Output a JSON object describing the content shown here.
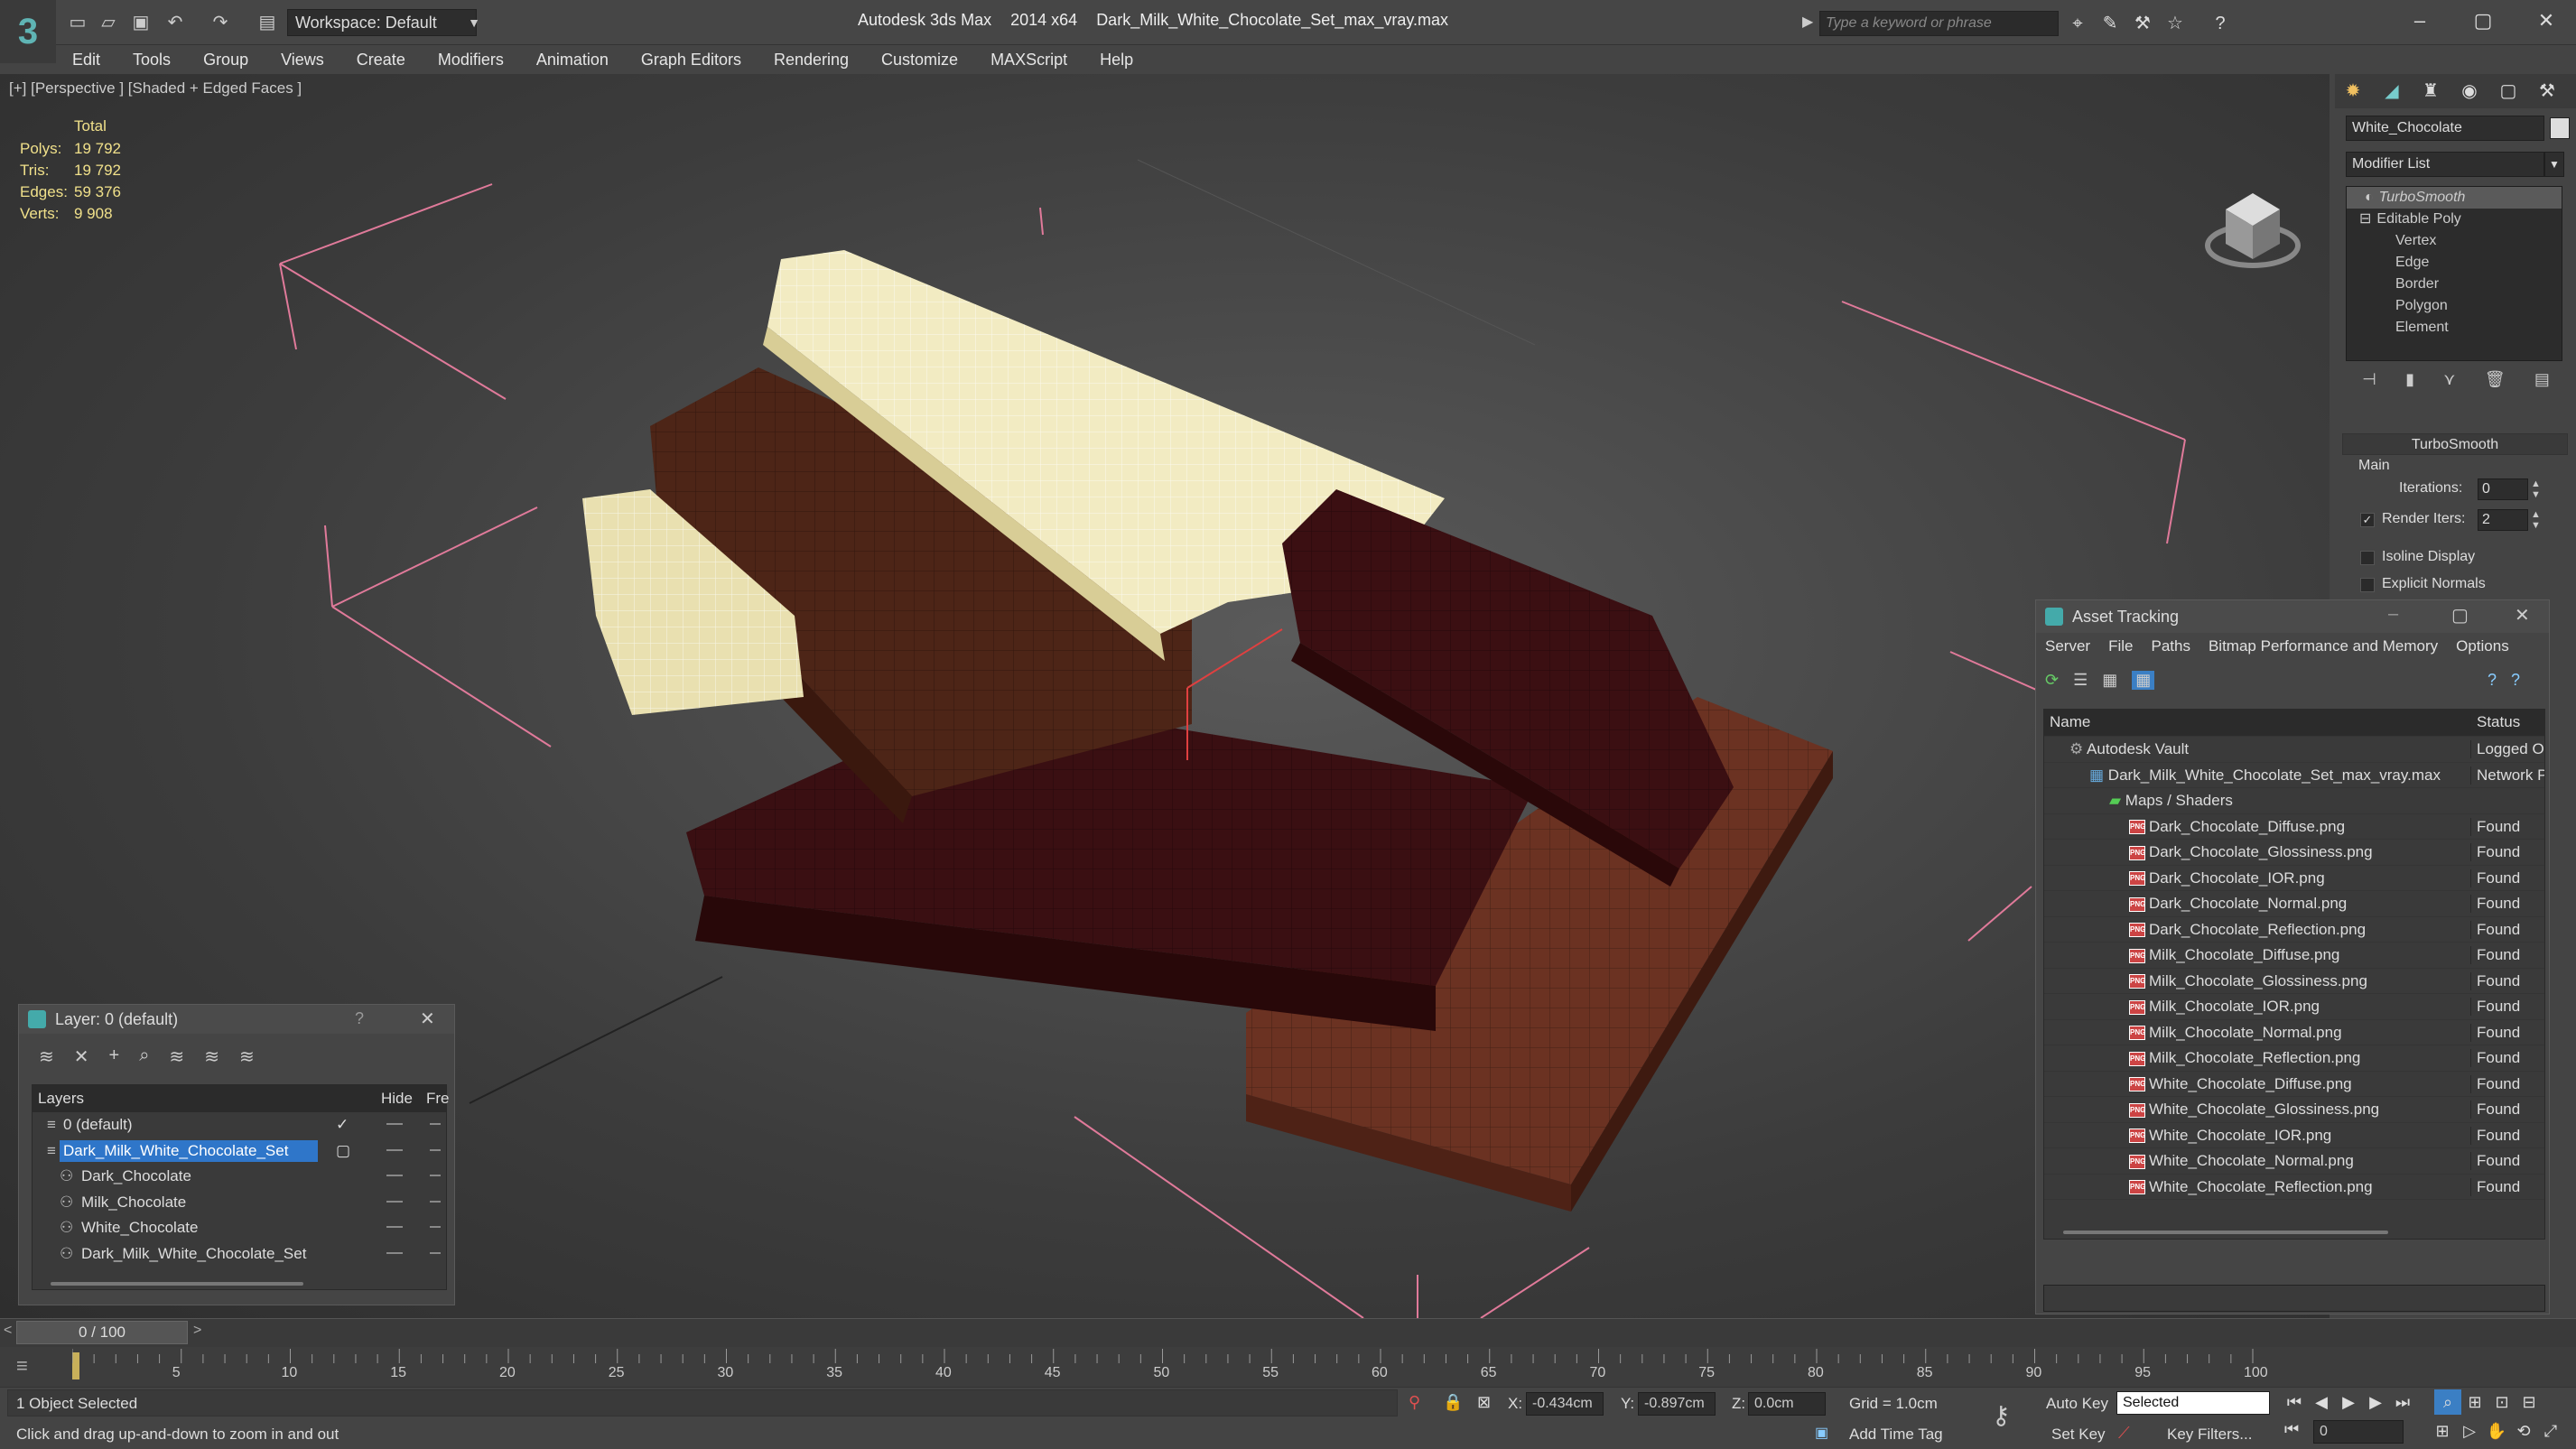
{
  "window": {
    "app_name": "Autodesk 3ds Max",
    "version": "2014 x64",
    "file": "Dark_Milk_White_Chocolate_Set_max_vray.max",
    "workspace": "Workspace: Default",
    "search_placeholder": "Type a keyword or phrase"
  },
  "menu": [
    "Edit",
    "Tools",
    "Group",
    "Views",
    "Create",
    "Modifiers",
    "Animation",
    "Graph Editors",
    "Rendering",
    "Customize",
    "MAXScript",
    "Help"
  ],
  "viewport": {
    "label": "[+] [Perspective ] [Shaded + Edged Faces ]",
    "stats": {
      "header": "Total",
      "rows": [
        {
          "label": "Polys:",
          "value": "19 792"
        },
        {
          "label": "Tris:",
          "value": "19 792"
        },
        {
          "label": "Edges:",
          "value": "59 376"
        },
        {
          "label": "Verts:",
          "value": "9 908"
        }
      ]
    }
  },
  "command_panel": {
    "object_name": "White_Chocolate",
    "modifier_list": "Modifier List",
    "stack": [
      "TurboSmooth",
      "Editable Poly",
      "Vertex",
      "Edge",
      "Border",
      "Polygon",
      "Element"
    ],
    "rollout_title": "TurboSmooth",
    "group_main": "Main",
    "iterations_label": "Iterations:",
    "iterations_value": "0",
    "render_iters_label": "Render Iters:",
    "render_iters_value": "2",
    "isoline_label": "Isoline Display",
    "explicit_label": "Explicit Normals"
  },
  "asset_tracking": {
    "title": "Asset Tracking",
    "menu": [
      "Server",
      "File",
      "Paths",
      "Bitmap Performance and Memory",
      "Options"
    ],
    "columns": [
      "Name",
      "Status"
    ],
    "rows": [
      {
        "name": "Autodesk Vault",
        "status": "Logged Ou",
        "level": 0,
        "kind": "vault"
      },
      {
        "name": "Dark_Milk_White_Chocolate_Set_max_vray.max",
        "status": "Network P",
        "level": 1,
        "kind": "max"
      },
      {
        "name": "Maps / Shaders",
        "status": "",
        "level": 2,
        "kind": "folder"
      },
      {
        "name": "Dark_Chocolate_Diffuse.png",
        "status": "Found",
        "level": 3,
        "kind": "png"
      },
      {
        "name": "Dark_Chocolate_Glossiness.png",
        "status": "Found",
        "level": 3,
        "kind": "png"
      },
      {
        "name": "Dark_Chocolate_IOR.png",
        "status": "Found",
        "level": 3,
        "kind": "png"
      },
      {
        "name": "Dark_Chocolate_Normal.png",
        "status": "Found",
        "level": 3,
        "kind": "png"
      },
      {
        "name": "Dark_Chocolate_Reflection.png",
        "status": "Found",
        "level": 3,
        "kind": "png"
      },
      {
        "name": "Milk_Chocolate_Diffuse.png",
        "status": "Found",
        "level": 3,
        "kind": "png"
      },
      {
        "name": "Milk_Chocolate_Glossiness.png",
        "status": "Found",
        "level": 3,
        "kind": "png"
      },
      {
        "name": "Milk_Chocolate_IOR.png",
        "status": "Found",
        "level": 3,
        "kind": "png"
      },
      {
        "name": "Milk_Chocolate_Normal.png",
        "status": "Found",
        "level": 3,
        "kind": "png"
      },
      {
        "name": "Milk_Chocolate_Reflection.png",
        "status": "Found",
        "level": 3,
        "kind": "png"
      },
      {
        "name": "White_Chocolate_Diffuse.png",
        "status": "Found",
        "level": 3,
        "kind": "png"
      },
      {
        "name": "White_Chocolate_Glossiness.png",
        "status": "Found",
        "level": 3,
        "kind": "png"
      },
      {
        "name": "White_Chocolate_IOR.png",
        "status": "Found",
        "level": 3,
        "kind": "png"
      },
      {
        "name": "White_Chocolate_Normal.png",
        "status": "Found",
        "level": 3,
        "kind": "png"
      },
      {
        "name": "White_Chocolate_Reflection.png",
        "status": "Found",
        "level": 3,
        "kind": "png"
      }
    ]
  },
  "layer_panel": {
    "title": "Layer: 0 (default)",
    "help": "?",
    "columns": [
      "Layers",
      "Hide",
      "Fre"
    ],
    "rows": [
      {
        "name": "0 (default)",
        "level": 0,
        "selected": false,
        "check": "✓"
      },
      {
        "name": "Dark_Milk_White_Chocolate_Set",
        "level": 0,
        "selected": true,
        "check": "▢"
      },
      {
        "name": "Dark_Chocolate",
        "level": 1,
        "selected": false,
        "check": ""
      },
      {
        "name": "Milk_Chocolate",
        "level": 1,
        "selected": false,
        "check": ""
      },
      {
        "name": "White_Chocolate",
        "level": 1,
        "selected": false,
        "check": ""
      },
      {
        "name": "Dark_Milk_White_Chocolate_Set",
        "level": 1,
        "selected": false,
        "check": ""
      }
    ]
  },
  "timeline": {
    "frame": "0 / 100",
    "ticks": [
      "5",
      "10",
      "15",
      "20",
      "25",
      "30",
      "35",
      "40",
      "45",
      "50",
      "55",
      "60",
      "65",
      "70",
      "75",
      "80",
      "85",
      "90",
      "95",
      "100"
    ]
  },
  "status": {
    "selection": "1 Object Selected",
    "prompt": "Click and drag up-and-down to zoom in and out",
    "x_label": "X:",
    "x_value": "-0.434cm",
    "y_label": "Y:",
    "y_value": "-0.897cm",
    "z_label": "Z:",
    "z_value": "0.0cm",
    "grid": "Grid = 1.0cm",
    "add_time_tag": "Add Time Tag",
    "auto_key": "Auto Key",
    "set_key": "Set Key",
    "selected": "Selected",
    "key_filters": "Key Filters...",
    "frame_field": "0"
  }
}
